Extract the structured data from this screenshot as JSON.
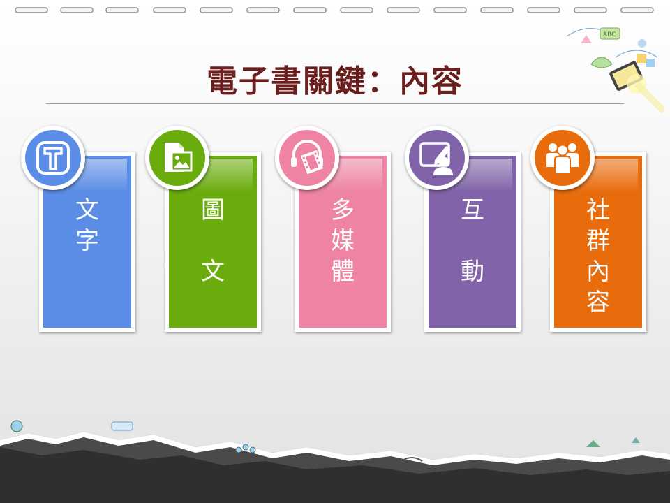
{
  "title": "電子書關鍵：內容",
  "cards": [
    {
      "label": "文\n字",
      "color": "#5b8de6",
      "icon": "text-t-icon"
    },
    {
      "label": "圖\n\n文",
      "color": "#6aac0e",
      "icon": "image-file-icon"
    },
    {
      "label": "多\n媒\n體",
      "color": "#ee83a3",
      "icon": "headphones-film-icon"
    },
    {
      "label": "互\n\n動",
      "color": "#8063a8",
      "icon": "edit-user-icon"
    },
    {
      "label": "社\n群\n內\n容",
      "color": "#e86c0c",
      "icon": "community-people-icon"
    }
  ]
}
